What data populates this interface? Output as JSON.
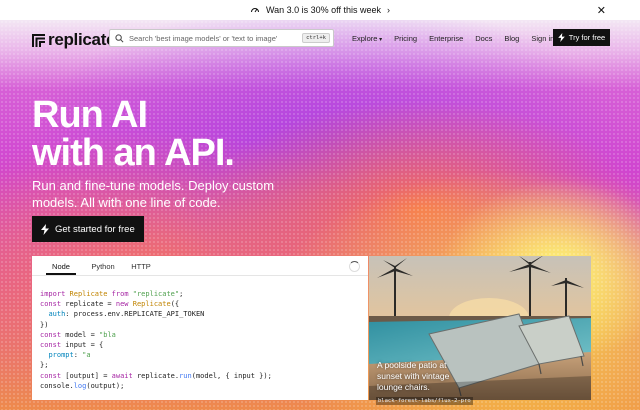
{
  "banner": {
    "text": "Wan 3.0 is 30% off this week"
  },
  "nav": {
    "logo": "replicate",
    "search_placeholder": "Search 'best image models' or 'text to image'",
    "search_shortcut": "ctrl+k",
    "links": {
      "explore": "Explore",
      "pricing": "Pricing",
      "enterprise": "Enterprise",
      "docs": "Docs",
      "blog": "Blog",
      "signin": "Sign in"
    },
    "cta": "Try for free"
  },
  "hero": {
    "title_line1": "Run AI",
    "title_line2": "with an API.",
    "subtitle": "Run and fine-tune models. Deploy custom models. All with one line of code.",
    "start_button": "Get started for free"
  },
  "code_card": {
    "tabs": [
      "Node",
      "Python",
      "HTTP"
    ],
    "active_tab": "Node"
  },
  "image_card": {
    "caption": "A poolside patio at sunset with vintage lounge chairs.",
    "model": "black-forest-labs/flux-2-pro"
  }
}
